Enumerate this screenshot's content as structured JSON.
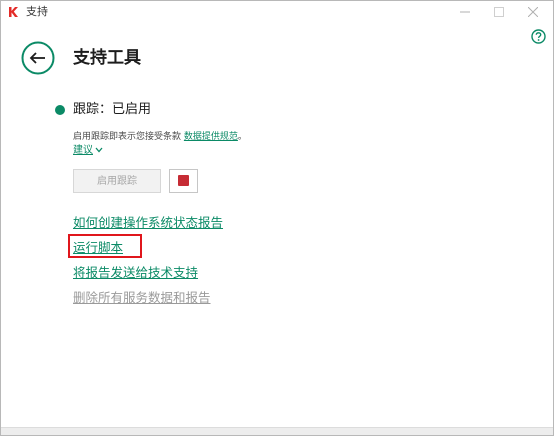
{
  "window": {
    "title": "支持",
    "icons": {
      "app": "kaspersky-k-icon",
      "minimize": "minimize-icon",
      "maximize": "maximize-icon",
      "close": "close-icon",
      "help": "help-icon",
      "back": "back-arrow-icon"
    }
  },
  "page": {
    "title": "支持工具"
  },
  "tracing": {
    "status": "跟踪：已启用",
    "status_color": "#0b8a66",
    "consent_prefix": "启用跟踪即表示您接受条款",
    "consent_link": "数据提供规范",
    "consent_suffix": "。",
    "suggest_label": "建议",
    "enable_button": "启用跟踪",
    "stop_color": "#c62c35"
  },
  "links": {
    "create_report": "如何创建操作系统状态报告",
    "run_script": "运行脚本",
    "send_report": "将报告发送给技术支持",
    "delete_data": "删除所有服务数据和报告"
  },
  "colors": {
    "accent": "#0b8a66",
    "highlight": "#e0161c",
    "disabled_text": "#9a9a9a"
  }
}
